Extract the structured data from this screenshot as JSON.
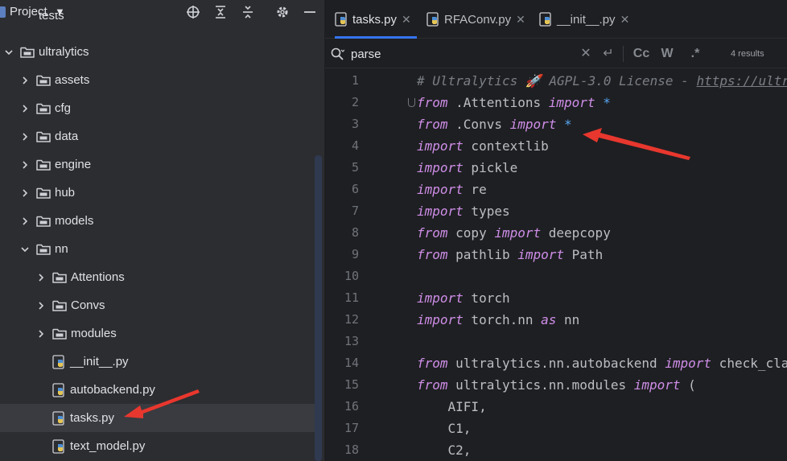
{
  "project": {
    "title": "Project",
    "top_clipped": "tests",
    "tree": [
      {
        "label": "ultralytics",
        "type": "folder",
        "expanded": true
      },
      {
        "label": "assets",
        "type": "folder",
        "expanded": false
      },
      {
        "label": "cfg",
        "type": "folder",
        "expanded": false
      },
      {
        "label": "data",
        "type": "folder",
        "expanded": false
      },
      {
        "label": "engine",
        "type": "folder",
        "expanded": false
      },
      {
        "label": "hub",
        "type": "folder",
        "expanded": false
      },
      {
        "label": "models",
        "type": "folder",
        "expanded": false
      },
      {
        "label": "nn",
        "type": "folder",
        "expanded": true
      },
      {
        "label": "Attentions",
        "type": "folder",
        "expanded": false
      },
      {
        "label": "Convs",
        "type": "folder",
        "expanded": false
      },
      {
        "label": "modules",
        "type": "folder",
        "expanded": false
      },
      {
        "label": "__init__.py",
        "type": "python-file"
      },
      {
        "label": "autobackend.py",
        "type": "python-file"
      },
      {
        "label": "tasks.py",
        "type": "python-file",
        "selected": true
      },
      {
        "label": "text_model.py",
        "type": "python-file"
      }
    ]
  },
  "tabs": [
    {
      "label": "tasks.py",
      "active": true
    },
    {
      "label": "RFAConv.py",
      "active": false
    },
    {
      "label": "__init__.py",
      "active": false
    }
  ],
  "find": {
    "query": "parse",
    "match_case_label": "Cc",
    "whole_word_label": "W",
    "regex_label": ".*",
    "results": "4 results"
  },
  "code": {
    "line_numbers": [
      "1",
      "2",
      "3",
      "4",
      "5",
      "6",
      "7",
      "8",
      "9",
      "10",
      "11",
      "12",
      "13",
      "14",
      "15",
      "16",
      "17",
      "18"
    ],
    "lines": [
      {
        "parts": [
          {
            "t": "# Ultralytics 🚀 AGPL-3.0 License - ",
            "c": "cm"
          },
          {
            "t": "https://ultralytics.com/license",
            "c": "cm-link"
          }
        ]
      },
      {
        "parts": [
          {
            "t": "from",
            "c": "kw"
          },
          {
            "t": " .Attentions ",
            "c": ""
          },
          {
            "t": "import",
            "c": "kw"
          },
          {
            "t": " ",
            "c": ""
          },
          {
            "t": "*",
            "c": "op"
          }
        ]
      },
      {
        "parts": [
          {
            "t": "from",
            "c": "kw"
          },
          {
            "t": " .Convs ",
            "c": ""
          },
          {
            "t": "import",
            "c": "kw"
          },
          {
            "t": " ",
            "c": ""
          },
          {
            "t": "*",
            "c": "op"
          }
        ]
      },
      {
        "parts": [
          {
            "t": "import",
            "c": "kw"
          },
          {
            "t": " contextlib",
            "c": ""
          }
        ]
      },
      {
        "parts": [
          {
            "t": "import",
            "c": "kw"
          },
          {
            "t": " pickle",
            "c": ""
          }
        ]
      },
      {
        "parts": [
          {
            "t": "import",
            "c": "kw"
          },
          {
            "t": " re",
            "c": ""
          }
        ]
      },
      {
        "parts": [
          {
            "t": "import",
            "c": "kw"
          },
          {
            "t": " types",
            "c": ""
          }
        ]
      },
      {
        "parts": [
          {
            "t": "from",
            "c": "kw"
          },
          {
            "t": " copy ",
            "c": ""
          },
          {
            "t": "import",
            "c": "kw"
          },
          {
            "t": " deepcopy",
            "c": ""
          }
        ]
      },
      {
        "parts": [
          {
            "t": "from",
            "c": "kw"
          },
          {
            "t": " pathlib ",
            "c": ""
          },
          {
            "t": "import",
            "c": "kw"
          },
          {
            "t": " Path",
            "c": ""
          }
        ]
      },
      {
        "parts": []
      },
      {
        "parts": [
          {
            "t": "import",
            "c": "kw"
          },
          {
            "t": " torch",
            "c": ""
          }
        ]
      },
      {
        "parts": [
          {
            "t": "import",
            "c": "kw"
          },
          {
            "t": " torch.nn ",
            "c": ""
          },
          {
            "t": "as",
            "c": "kw"
          },
          {
            "t": " nn",
            "c": ""
          }
        ]
      },
      {
        "parts": []
      },
      {
        "parts": [
          {
            "t": "from",
            "c": "kw"
          },
          {
            "t": " ultralytics.nn.autobackend ",
            "c": ""
          },
          {
            "t": "import",
            "c": "kw"
          },
          {
            "t": " check_class_names",
            "c": ""
          }
        ]
      },
      {
        "parts": [
          {
            "t": "from",
            "c": "kw"
          },
          {
            "t": " ultralytics.nn.modules ",
            "c": ""
          },
          {
            "t": "import",
            "c": "kw"
          },
          {
            "t": " (",
            "c": ""
          }
        ]
      },
      {
        "parts": [
          {
            "t": "    AIFI,",
            "c": ""
          }
        ]
      },
      {
        "parts": [
          {
            "t": "    C1,",
            "c": ""
          }
        ]
      },
      {
        "parts": [
          {
            "t": "    C2,",
            "c": ""
          }
        ]
      }
    ]
  },
  "colors": {
    "keyword": "#cf8ee8",
    "comment": "#7a7e85",
    "operator": "#56a8f5",
    "annotation_arrow": "#e8372e",
    "tab_active_underline": "#3574f0"
  }
}
